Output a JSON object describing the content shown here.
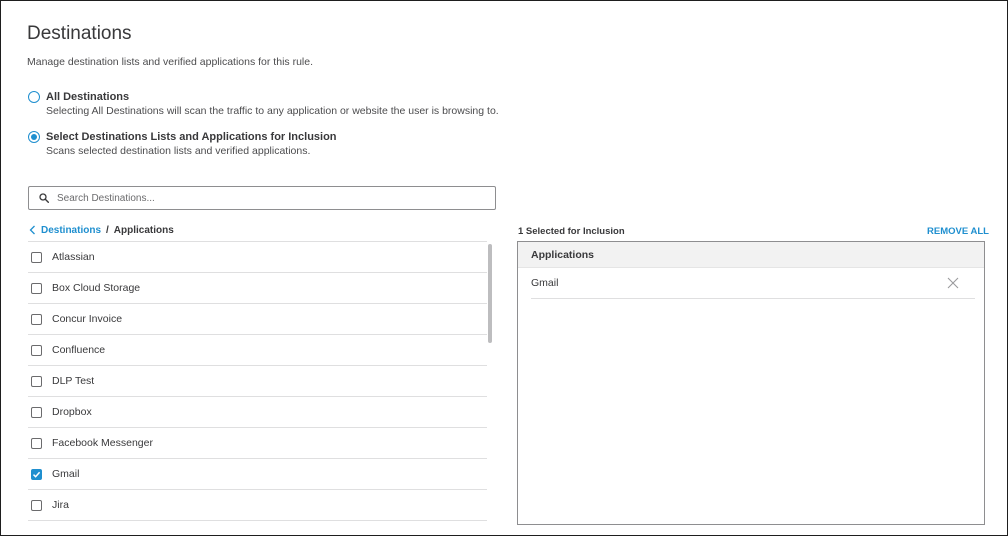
{
  "header": {
    "title": "Destinations",
    "subtitle": "Manage destination lists and verified applications for this rule."
  },
  "options": [
    {
      "label": "All Destinations",
      "description": "Selecting All Destinations will scan the traffic to any application or website the user is browsing to.",
      "selected": false
    },
    {
      "label": "Select Destinations Lists and Applications for Inclusion",
      "description": "Scans selected destination lists and verified applications.",
      "selected": true
    }
  ],
  "search": {
    "placeholder": "Search Destinations...",
    "value": ""
  },
  "breadcrumb": {
    "parent": "Destinations",
    "separator": "/",
    "current": "Applications"
  },
  "applications": [
    {
      "label": "Atlassian",
      "checked": false
    },
    {
      "label": "Box Cloud Storage",
      "checked": false
    },
    {
      "label": "Concur Invoice",
      "checked": false
    },
    {
      "label": "Confluence",
      "checked": false
    },
    {
      "label": "DLP Test",
      "checked": false
    },
    {
      "label": "Dropbox",
      "checked": false
    },
    {
      "label": "Facebook Messenger",
      "checked": false
    },
    {
      "label": "Gmail",
      "checked": true
    },
    {
      "label": "Jira",
      "checked": false
    }
  ],
  "selection": {
    "count_label": "1 Selected for Inclusion",
    "remove_all_label": "REMOVE ALL",
    "group_header": "Applications",
    "items": [
      "Gmail"
    ]
  },
  "colors": {
    "accent": "#1f8fcf",
    "text": "#39393b",
    "border": "#8e8e90"
  },
  "icons": {
    "search": "search-icon",
    "back": "chevron-left-icon",
    "remove": "close-icon",
    "check": "checkmark-icon"
  }
}
